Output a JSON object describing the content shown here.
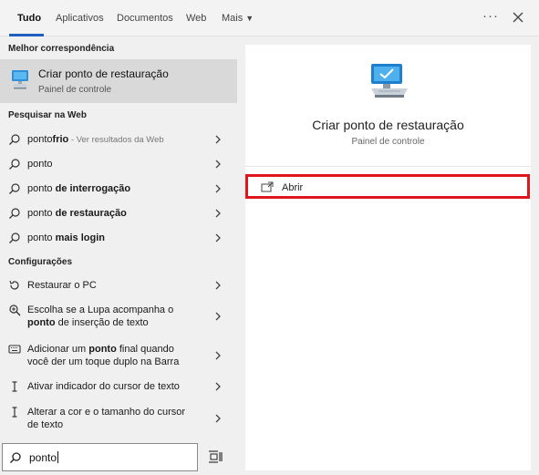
{
  "tabs": [
    {
      "label": "Tudo"
    },
    {
      "label": "Aplicativos"
    },
    {
      "label": "Documentos"
    },
    {
      "label": "Web"
    },
    {
      "label": "Mais"
    }
  ],
  "header": {
    "ellipsis": "···"
  },
  "left": {
    "best_match_title": "Melhor correspondência",
    "best_match": {
      "title": "Criar ponto de restauração",
      "subtitle": "Painel de controle"
    },
    "web_title": "Pesquisar na Web",
    "web_items": [
      {
        "pre": "ponto",
        "bold": "frio",
        "hint": " - Ver resultados da Web"
      },
      {
        "pre": "ponto",
        "bold": "",
        "hint": ""
      },
      {
        "pre": "ponto ",
        "bold": "de interrogação",
        "hint": ""
      },
      {
        "pre": "ponto ",
        "bold": "de restauração",
        "hint": ""
      },
      {
        "pre": "ponto ",
        "bold": "mais login",
        "hint": ""
      }
    ],
    "settings_title": "Configurações",
    "settings_items": [
      {
        "label": "Restaurar o PC",
        "icon": "restore-icon"
      },
      {
        "line1": "Escolha se a Lupa acompanha o",
        "bold": "ponto",
        "rest": " de inserção de texto",
        "icon": "magnifier-icon"
      },
      {
        "line1a": "Adicionar um ",
        "bold": "ponto",
        "line1b": " final quando",
        "line2": "você der um toque duplo na Barra",
        "icon": "keyboard-icon"
      },
      {
        "label": "Ativar indicador do cursor de texto",
        "icon": "text-cursor-icon"
      },
      {
        "label": "Alterar a cor e o tamanho do cursor de texto",
        "icon": "text-cursor-icon"
      }
    ]
  },
  "right": {
    "title": "Criar ponto de restauração",
    "subtitle": "Painel de controle",
    "action_open": "Abrir"
  },
  "search": {
    "value": "ponto"
  },
  "colors": {
    "accent": "#1f5fbf",
    "highlight": "#e0161e",
    "selected": "#d9d9d9"
  }
}
